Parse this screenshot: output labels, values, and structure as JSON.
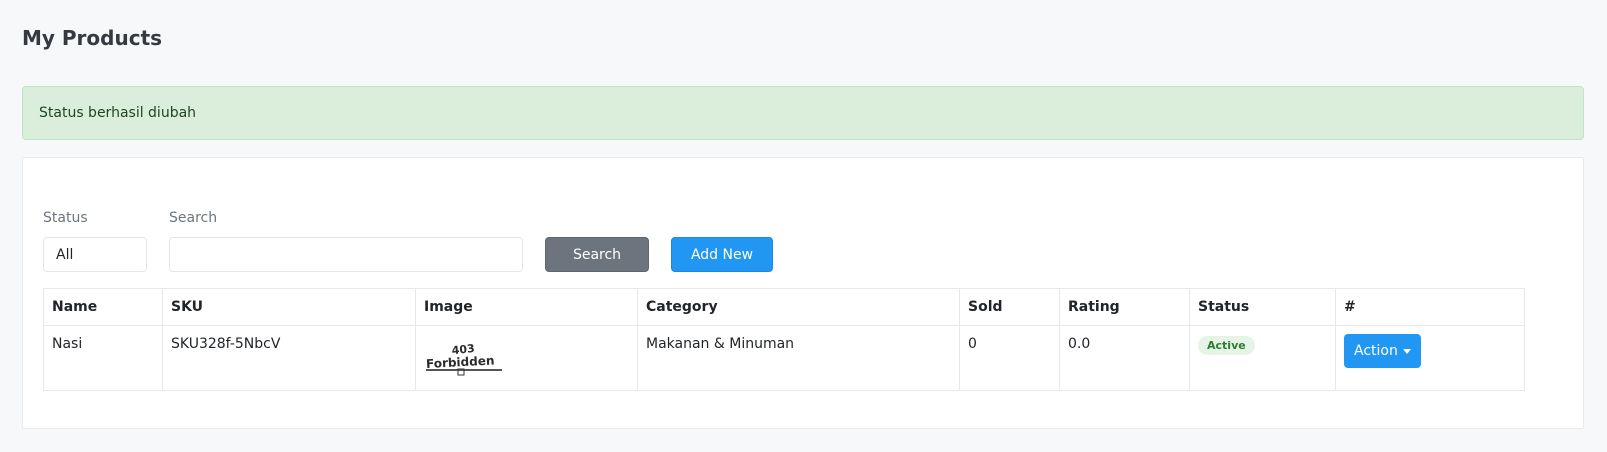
{
  "page": {
    "title": "My Products"
  },
  "alert": {
    "message": "Status berhasil diubah"
  },
  "filters": {
    "status_label": "Status",
    "status_value": "All",
    "search_label": "Search",
    "search_value": "",
    "search_button": "Search",
    "add_button": "Add New"
  },
  "table": {
    "headers": [
      "Name",
      "SKU",
      "Image",
      "Category",
      "Sold",
      "Rating",
      "Status",
      "#"
    ],
    "rows": [
      {
        "name": "Nasi",
        "sku": "SKU328f-5NbcV",
        "image_text": "403 Forbidden",
        "category": "Makanan & Minuman",
        "sold": "0",
        "rating": "0.0",
        "status": "Active",
        "action": "Action"
      }
    ]
  },
  "colors": {
    "primary": "#2196f3",
    "secondary": "#6c757d",
    "success_bg": "#dbeedb",
    "badge_text": "#2e7d32"
  }
}
